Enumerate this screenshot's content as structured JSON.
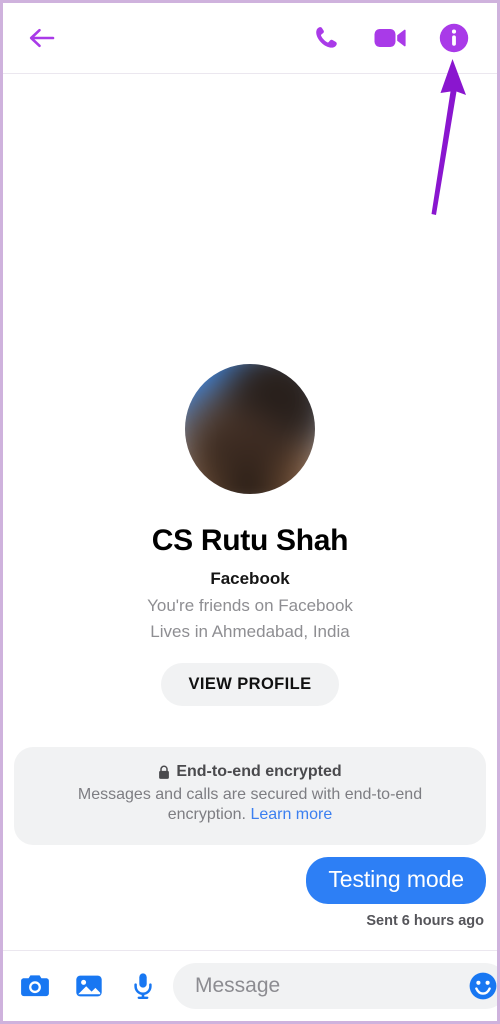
{
  "colors": {
    "accent_purple": "#a93ae8",
    "arrow_purple": "#8a16cf",
    "frame_border": "#cfb2dd",
    "messenger_blue": "#2d7ff5",
    "icon_blue": "#1877f2",
    "link_blue": "#3b7ff0",
    "pill_grey": "#f1f2f3",
    "muted_text": "#8e8e92"
  },
  "header": {
    "back_icon": "back-arrow-icon",
    "actions": [
      {
        "id": "audio-call",
        "icon": "phone-icon",
        "label": "Audio call"
      },
      {
        "id": "video-call",
        "icon": "video-camera-icon",
        "label": "Video call"
      },
      {
        "id": "conversation-info",
        "icon": "info-circle-icon",
        "label": "Conversation information"
      }
    ]
  },
  "annotation": {
    "type": "arrow",
    "points_to": "conversation-info",
    "color": "#8a16cf"
  },
  "profile": {
    "avatar_alt": "CS Rutu Shah profile photo",
    "name": "CS Rutu Shah",
    "platform": "Facebook",
    "relationship": "You're friends on Facebook",
    "location": "Lives in Ahmedabad, India",
    "view_profile_label": "VIEW PROFILE"
  },
  "encryption_notice": {
    "lock_icon": "lock-icon",
    "title": "End-to-end encrypted",
    "body": "Messages and calls are secured with end-to-end encryption.",
    "link_label": "Learn more"
  },
  "messages": [
    {
      "id": "msg-1",
      "text": "Testing mode",
      "direction": "outgoing",
      "status": "Sent 6 hours ago"
    }
  ],
  "composer": {
    "camera_icon": "camera-icon",
    "gallery_icon": "image-gallery-icon",
    "mic_icon": "microphone-icon",
    "input_value": "",
    "input_placeholder": "Message",
    "emoji_icon": "emoji-smiley-icon",
    "like_icon": "thumbs-up-icon"
  }
}
